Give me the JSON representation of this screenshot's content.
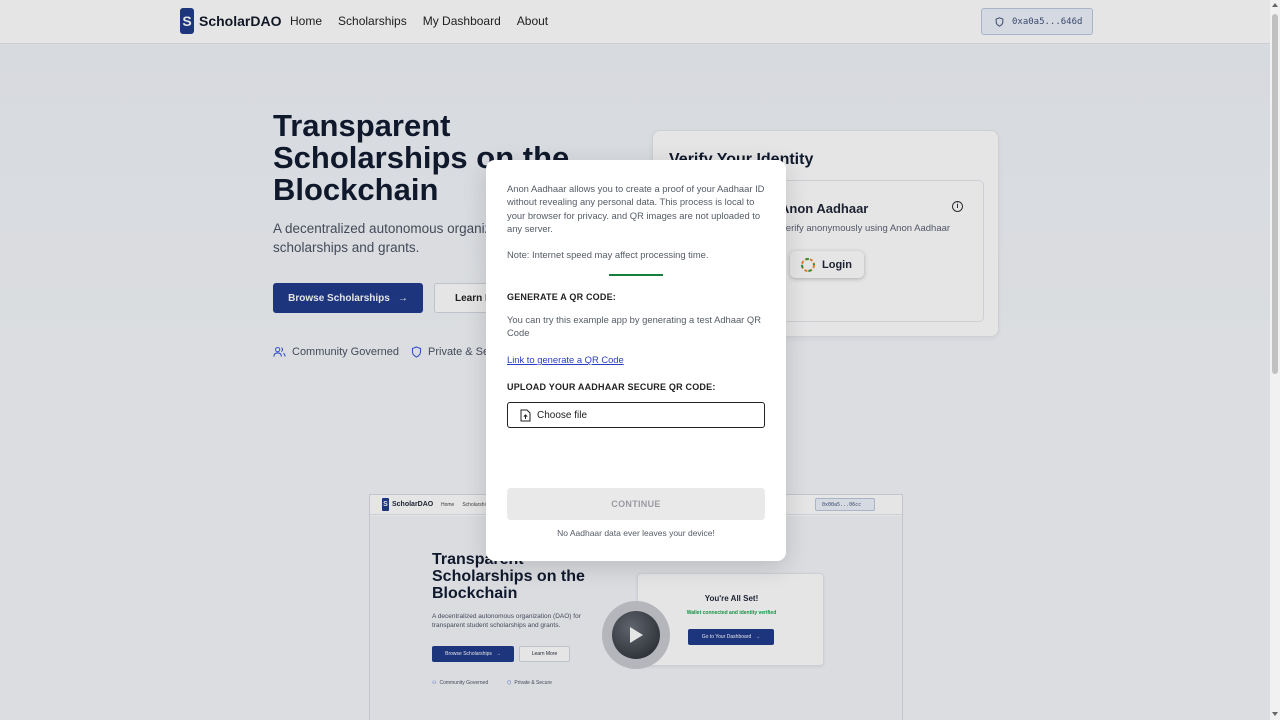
{
  "nav": {
    "logo_letter": "S",
    "brand": "ScholarDAO",
    "links": [
      "Home",
      "Scholarships",
      "My Dashboard",
      "About"
    ],
    "wallet": "0xa0a5...646d"
  },
  "hero": {
    "title": "Transparent Scholarships on the Blockchain",
    "subtitle": "A decentralized autonomous organization (DAO) for transparent student scholarships and grants.",
    "primary_button": "Browse Scholarships",
    "secondary_button": "Learn More",
    "features": [
      "Community Governed",
      "Private & Secure"
    ]
  },
  "verify": {
    "title": "Verify Your Identity",
    "box_title": "Anon Aadhaar",
    "box_subtitle": "Verify anonymously using Anon Aadhaar",
    "login_label": "Login"
  },
  "preview": {
    "logo_letter": "S",
    "brand": "ScholarDAO",
    "links": [
      "Home",
      "Scholarships"
    ],
    "wallet": "0x00a5...06cc",
    "title": "Transparent Scholarships on the Blockchain",
    "subtitle": "A decentralized autonomous organization (DAO) for transparent student scholarships and grants.",
    "primary_button": "Browse Scholarships",
    "secondary_button": "Learn More",
    "features": [
      "Community Governed",
      "Private & Secure"
    ],
    "card_title": "You're All Set!",
    "card_subtitle": "Wallet connected and identity verified",
    "card_button": "Go to Your Dashboard"
  },
  "modal": {
    "description": "Anon Aadhaar allows you to create a proof of your Aadhaar ID without revealing any personal data. This process is local to your browser for privacy. and QR images are not uploaded to any server.",
    "note": "Note: Internet speed may affect processing time.",
    "generate_heading": "GENERATE A QR CODE:",
    "generate_text": "You can try this example app by generating a test Adhaar QR Code",
    "generate_link": "Link to generate a QR Code",
    "upload_heading": "UPLOAD YOUR AADHAAR SECURE QR CODE:",
    "file_label": "Choose file",
    "continue_label": "CONTINUE",
    "footer": "No Aadhaar data ever leaves your device!"
  },
  "colors": {
    "brand": "#1e3a8a",
    "success": "#16a34a",
    "link": "#2b3cc4"
  }
}
